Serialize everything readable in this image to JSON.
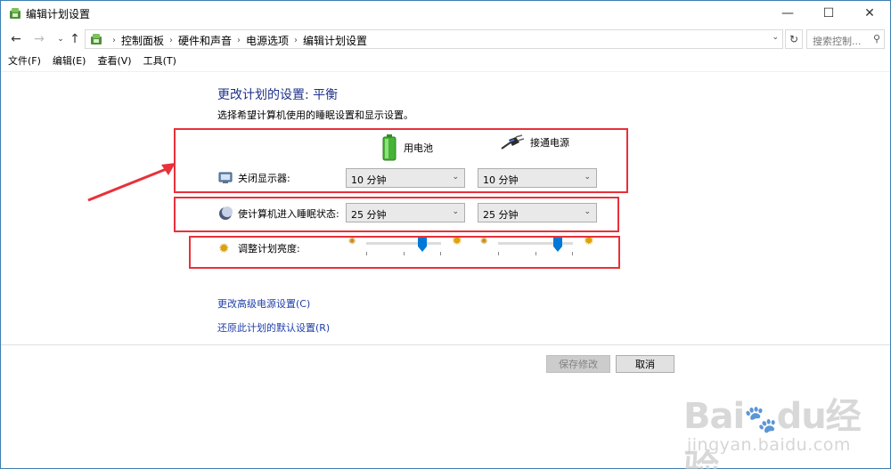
{
  "window": {
    "title": "编辑计划设置"
  },
  "controls": {
    "minimize": "—",
    "maximize": "☐",
    "close": "✕"
  },
  "nav": {
    "back": "←",
    "forward": "→",
    "recent": "⌄",
    "up": "↑",
    "breadcrumbs": [
      "控制面板",
      "硬件和声音",
      "电源选项",
      "编辑计划设置"
    ],
    "refresh": "↻",
    "search_placeholder": "搜索控制...",
    "dropdown": "⌄"
  },
  "menu": [
    "文件(F)",
    "编辑(E)",
    "查看(V)",
    "工具(T)"
  ],
  "page": {
    "heading": "更改计划的设置: 平衡",
    "subheading": "选择希望计算机使用的睡眠设置和显示设置。",
    "col_battery": "用电池",
    "col_plugged": "接通电源",
    "rows": {
      "display_off": {
        "label": "关闭显示器:",
        "battery": "10 分钟",
        "plugged": "10 分钟"
      },
      "sleep": {
        "label": "使计算机进入睡眠状态:",
        "battery": "25 分钟",
        "plugged": "25 分钟"
      },
      "brightness": {
        "label": "调整计划亮度:",
        "battery_level": 0.75,
        "plugged_level": 0.8
      }
    },
    "links": {
      "advanced": "更改高级电源设置(C)",
      "restore": "还原此计划的默认设置(R)"
    }
  },
  "buttons": {
    "save": "保存修改",
    "cancel": "取消"
  },
  "annotation_color": "#e8313a",
  "watermark": {
    "logo": "Baidu经验",
    "url": "jingyan.baidu.com"
  },
  "icons": [
    "control-panel-icon",
    "battery-icon",
    "plug-icon",
    "monitor-icon",
    "moon-icon",
    "sun-icon",
    "search-icon"
  ]
}
